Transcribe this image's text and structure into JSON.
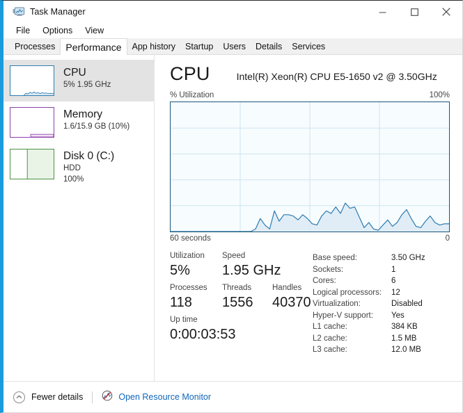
{
  "window": {
    "title": "Task Manager",
    "icon": "task-manager-icon",
    "controls": {
      "minimize": "—",
      "maximize": "☐",
      "close": "✕"
    }
  },
  "menu": {
    "items": [
      {
        "label": "File"
      },
      {
        "label": "Options"
      },
      {
        "label": "View"
      }
    ]
  },
  "tabs": {
    "active": "Performance",
    "items": [
      {
        "label": "Processes"
      },
      {
        "label": "Performance"
      },
      {
        "label": "App history"
      },
      {
        "label": "Startup"
      },
      {
        "label": "Users"
      },
      {
        "label": "Details"
      },
      {
        "label": "Services"
      }
    ]
  },
  "sidebar": {
    "items": [
      {
        "name": "CPU",
        "title": "CPU",
        "subtitle": "5%  1.95 GHz",
        "subtitle2": "",
        "selected": true,
        "color": "#2c7cb0"
      },
      {
        "name": "Memory",
        "title": "Memory",
        "subtitle": "1.6/15.9 GB (10%)",
        "subtitle2": "",
        "selected": false,
        "color": "#8b3fa8"
      },
      {
        "name": "Disk 0 (C:)",
        "title": "Disk 0 (C:)",
        "subtitle": "HDD",
        "subtitle2": "100%",
        "selected": false,
        "color": "#4a9141"
      }
    ]
  },
  "panel": {
    "title": "CPU",
    "model": "Intel(R) Xeon(R) CPU E5-1650 v2 @ 3.50GHz",
    "graph_top_left_label": "% Utilization",
    "graph_top_right_label": "100%",
    "graph_bottom_left_label": "60 seconds",
    "graph_bottom_right_label": "0",
    "stats": {
      "utilization_label": "Utilization",
      "utilization_value": "5%",
      "speed_label": "Speed",
      "speed_value": "1.95 GHz",
      "processes_label": "Processes",
      "processes_value": "118",
      "threads_label": "Threads",
      "threads_value": "1556",
      "handles_label": "Handles",
      "handles_value": "40370",
      "uptime_label": "Up time",
      "uptime_value": "0:00:03:53"
    },
    "specs": [
      {
        "key": "Base speed:",
        "value": "3.50 GHz"
      },
      {
        "key": "Sockets:",
        "value": "1"
      },
      {
        "key": "Cores:",
        "value": "6"
      },
      {
        "key": "Logical processors:",
        "value": "12"
      },
      {
        "key": "Virtualization:",
        "value": "Disabled"
      },
      {
        "key": "Hyper-V support:",
        "value": "Yes"
      },
      {
        "key": "L1 cache:",
        "value": "384 KB"
      },
      {
        "key": "L2 cache:",
        "value": "1.5 MB"
      },
      {
        "key": "L3 cache:",
        "value": "12.0 MB"
      }
    ]
  },
  "footer": {
    "fewer_details_label": "Fewer details",
    "fewer_details_icon": "chevron-up-icon",
    "resource_monitor_label": "Open Resource Monitor",
    "resource_monitor_icon": "resource-monitor-icon"
  },
  "colors": {
    "accent": "#1a9bdc",
    "graph_line": "#2c7cb0",
    "graph_border": "#19557a",
    "graph_fill": "#dceaf4",
    "grid_line": "#cfe4f0",
    "link": "#1166bb",
    "cpu": "#2c7cb0",
    "memory": "#8b3fa8",
    "disk": "#4a9141"
  },
  "chart_data": {
    "type": "area",
    "title": "% Utilization",
    "xlabel": "60 seconds",
    "ylabel": "% Utilization",
    "ylim": [
      0,
      100
    ],
    "xlim": [
      60,
      0
    ],
    "grid": true,
    "grid_rows": 5,
    "grid_cols": 4,
    "series": [
      {
        "name": "CPU utilization",
        "values": [
          0,
          0,
          0,
          0,
          0,
          0,
          0,
          0,
          0,
          0,
          0,
          0,
          0,
          0,
          0,
          0,
          0,
          0,
          2,
          10,
          5,
          2,
          16,
          8,
          13,
          13,
          12,
          9,
          13,
          10,
          6,
          5,
          12,
          16,
          14,
          19,
          14,
          22,
          18,
          19,
          11,
          3,
          7,
          2,
          1,
          5,
          9,
          4,
          7,
          13,
          17,
          10,
          4,
          3,
          8,
          12,
          7,
          5,
          6,
          6
        ]
      }
    ]
  }
}
